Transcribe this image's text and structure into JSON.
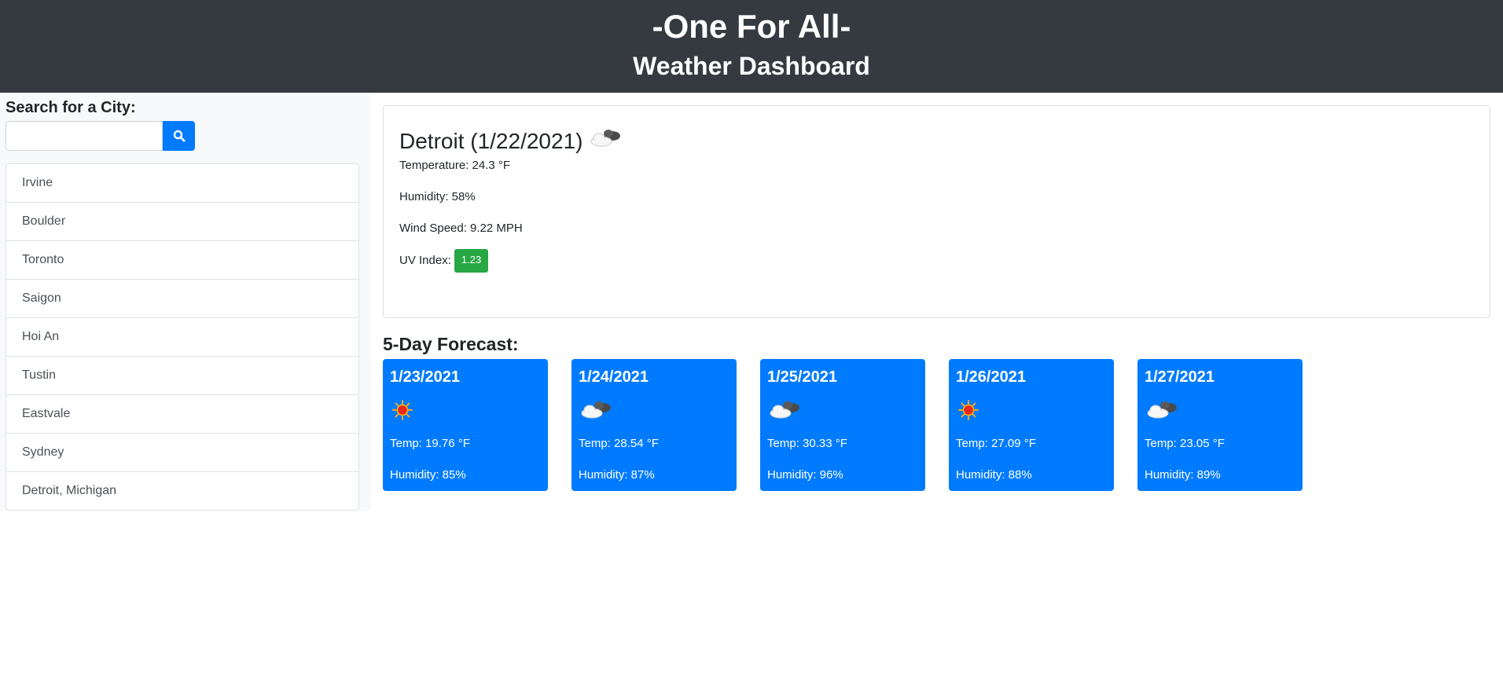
{
  "header": {
    "title": "-One For All-",
    "subtitle": "Weather Dashboard"
  },
  "search": {
    "label": "Search for a City:",
    "value": "",
    "placeholder": "",
    "button_icon": "search-icon"
  },
  "cities": [
    "Irvine",
    "Boulder",
    "Toronto",
    "Saigon",
    "Hoi An",
    "Tustin",
    "Eastvale",
    "Sydney",
    "Detroit, Michigan"
  ],
  "current": {
    "title": "Detroit (1/22/2021)",
    "icon": "partly-cloudy-icon",
    "temperature": "Temperature: 24.3 °F",
    "humidity": "Humidity: 58%",
    "wind": "Wind Speed: 9.22 MPH",
    "uv_label": "UV Index:",
    "uv_value": "1.23"
  },
  "forecast_title": "5-Day Forecast:",
  "forecast": [
    {
      "date": "1/23/2021",
      "icon": "sun-icon",
      "temp": "Temp: 19.76 °F",
      "humidity": "Humidity: 85%"
    },
    {
      "date": "1/24/2021",
      "icon": "cloud-icon",
      "temp": "Temp: 28.54 °F",
      "humidity": "Humidity: 87%"
    },
    {
      "date": "1/25/2021",
      "icon": "cloud-icon",
      "temp": "Temp: 30.33 °F",
      "humidity": "Humidity: 96%"
    },
    {
      "date": "1/26/2021",
      "icon": "sun-icon",
      "temp": "Temp: 27.09 °F",
      "humidity": "Humidity: 88%"
    },
    {
      "date": "1/27/2021",
      "icon": "cloud-icon",
      "temp": "Temp: 23.05 °F",
      "humidity": "Humidity: 89%"
    }
  ],
  "colors": {
    "header_bg": "#343a40",
    "accent": "#007bff",
    "uv_badge": "#28a745"
  }
}
